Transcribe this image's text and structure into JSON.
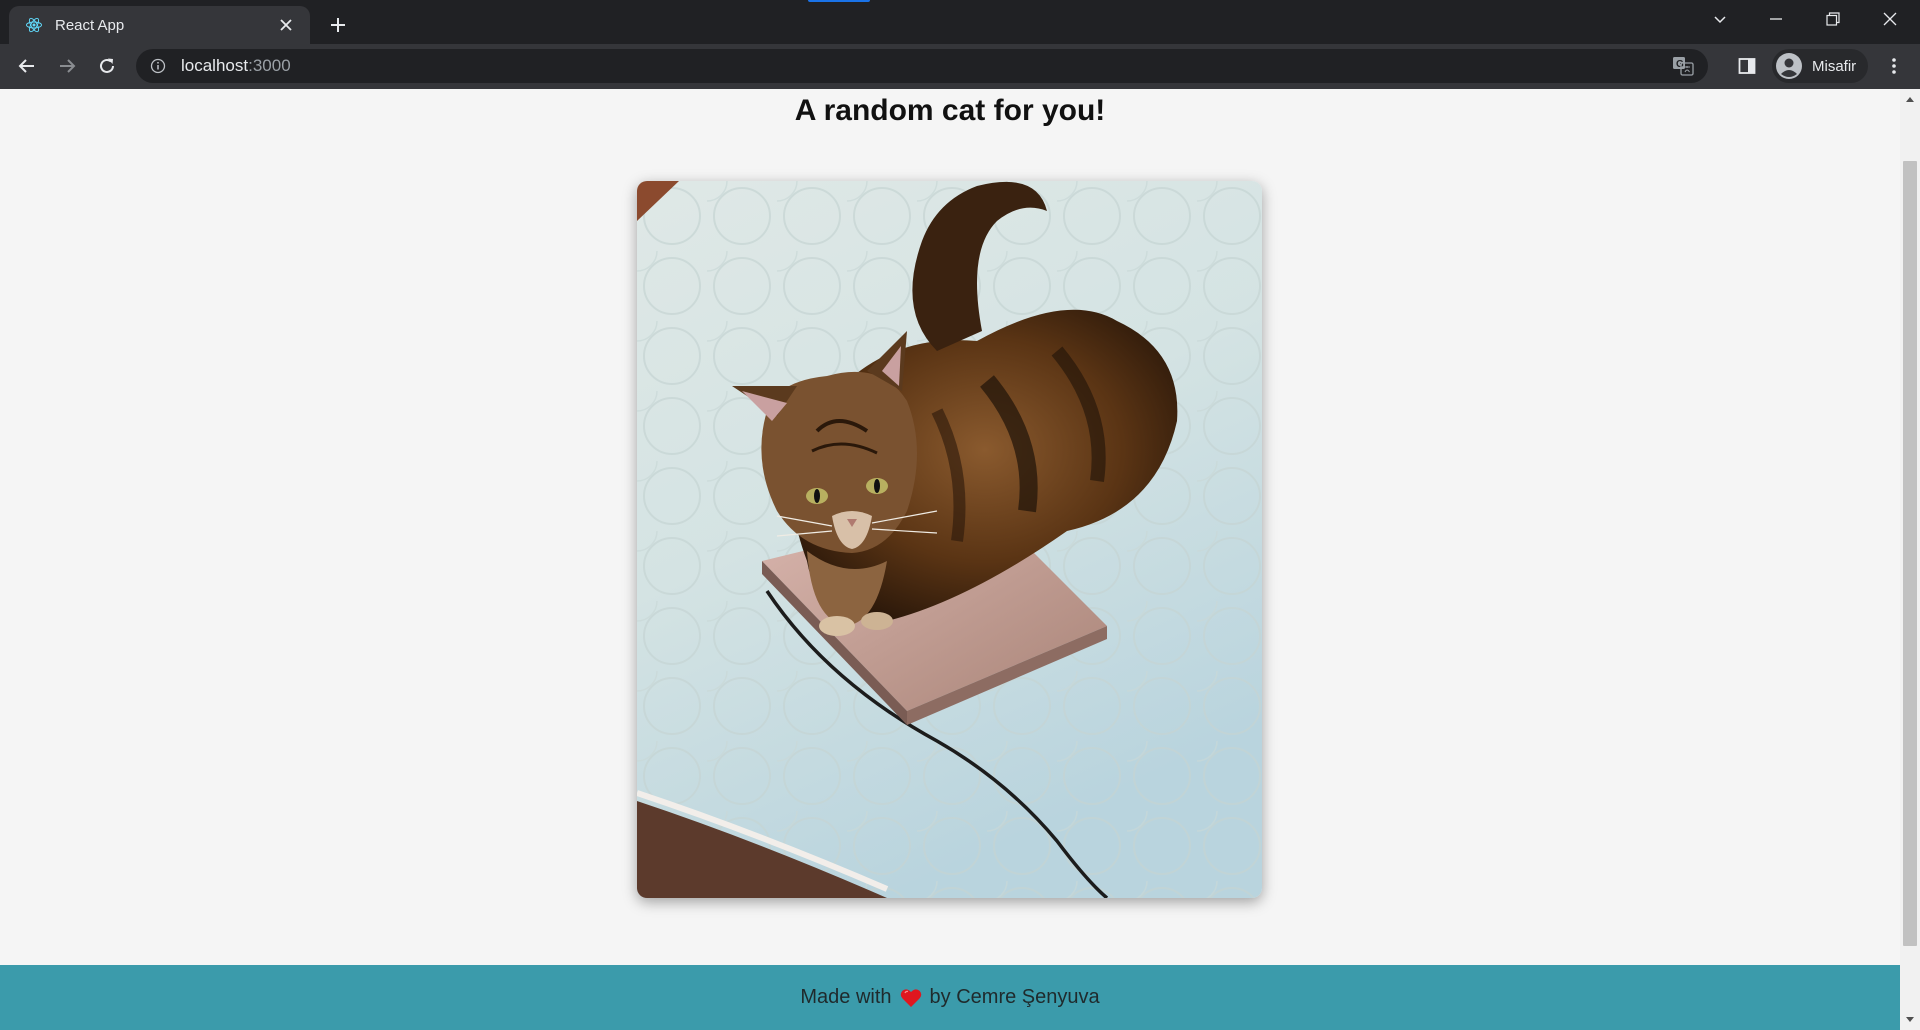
{
  "browser": {
    "tab": {
      "title": "React App",
      "favicon": "react-logo-icon"
    },
    "address": {
      "host": "localhost",
      "port": ":3000"
    },
    "profile": {
      "label": "Misafir",
      "icon": "guest-profile-icon"
    }
  },
  "page": {
    "title": "A random cat for you!",
    "image": {
      "alt": "random cat image",
      "subject": "long-haired tabby cat lying on a laptop on a quilted bedspread"
    },
    "footer": {
      "prefix": "Made with",
      "icon": "heart-icon",
      "suffix": "by Cemre Şenyuva"
    }
  },
  "colors": {
    "chrome_dark": "#202124",
    "chrome_tab": "#35363a",
    "page_background": "#f5f5f5",
    "footer_background": "#3b9bab",
    "heart": "#e0161f"
  }
}
